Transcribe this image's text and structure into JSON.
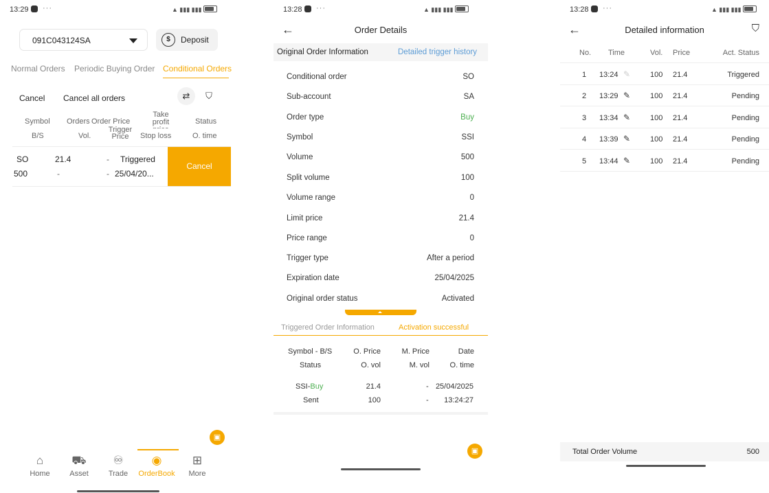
{
  "colors": {
    "accent": "#f5a800",
    "buy": "#4caf50",
    "link": "#5b9bd5",
    "muted": "#888888"
  },
  "screen1": {
    "status": {
      "time": "13:29",
      "dots": "···"
    },
    "account": {
      "value": "091C043124SA"
    },
    "deposit_label": "Deposit",
    "tabs": [
      "Normal Orders",
      "Periodic Buying Order",
      "Conditional Orders"
    ],
    "actions": {
      "cancel": "Cancel",
      "cancel_all": "Cancel all orders",
      "icon_refresh": "refresh-icon",
      "icon_filter": "filter-icon"
    },
    "headers": {
      "symbol": "Symbol",
      "bs": "B/S",
      "orders": "Orders",
      "vol": "Vol.",
      "order_price": "Order Price",
      "trigger_price": "Trigger Price",
      "take_profit": "Take profit price",
      "stop_loss": "Stop loss",
      "status": "Status",
      "otime": "O. time"
    },
    "row": {
      "symbol": "SO",
      "volume": "500",
      "order_price": "21.4",
      "trigger": "-",
      "take_profit": "-",
      "stop_loss": "-",
      "status": "Triggered",
      "time": "25/04/20...",
      "cancel": "Cancel"
    },
    "nav": [
      {
        "label": "Home",
        "icon": "home-icon"
      },
      {
        "label": "Asset",
        "icon": "asset-icon"
      },
      {
        "label": "Trade",
        "icon": "trade-icon"
      },
      {
        "label": "OrderBook",
        "icon": "orderbook-icon"
      },
      {
        "label": "More",
        "icon": "more-icon"
      }
    ]
  },
  "screen2": {
    "status": {
      "time": "13:28",
      "dots": "···"
    },
    "title": "Order Details",
    "tabs": [
      "Original Order Information",
      "Detailed trigger history"
    ],
    "fields": [
      {
        "label": "Conditional order",
        "value": "SO"
      },
      {
        "label": "Sub-account",
        "value": "SA"
      },
      {
        "label": "Order type",
        "value": "Buy"
      },
      {
        "label": "Symbol",
        "value": "SSI"
      },
      {
        "label": "Volume",
        "value": "500"
      },
      {
        "label": "Split volume",
        "value": "100"
      },
      {
        "label": "Volume range",
        "value": "0"
      },
      {
        "label": "Limit price",
        "value": "21.4"
      },
      {
        "label": "Price range",
        "value": "0"
      },
      {
        "label": "Trigger type",
        "value": "After a period"
      },
      {
        "label": "Expiration date",
        "value": "25/04/2025"
      },
      {
        "label": "Original order status",
        "value": "Activated"
      }
    ],
    "triggered": {
      "tab_label": "Triggered Order Information",
      "status_label": "Activation successful"
    },
    "thead": {
      "symbol_bs": "Symbol - B/S",
      "status": "Status",
      "oprice": "O. Price",
      "ovol": "O. vol",
      "mprice": "M. Price",
      "mvol": "M. vol",
      "date": "Date",
      "otime": "O. time"
    },
    "trow": {
      "symbol": "SSI-",
      "side": "Buy",
      "status": "Sent",
      "oprice": "21.4",
      "ovol": "100",
      "mprice": "-",
      "mvol": "-",
      "date": "25/04/2025",
      "otime": "13:24:27"
    }
  },
  "screen3": {
    "status": {
      "time": "13:28",
      "dots": "···"
    },
    "title": "Detailed information",
    "headers": {
      "no": "No.",
      "time": "Time",
      "vol": "Vol.",
      "price": "Price",
      "status": "Act. Status"
    },
    "rows": [
      {
        "no": "1",
        "time": "13:24",
        "vol": "100",
        "price": "21.4",
        "status": "Triggered"
      },
      {
        "no": "2",
        "time": "13:29",
        "vol": "100",
        "price": "21.4",
        "status": "Pending"
      },
      {
        "no": "3",
        "time": "13:34",
        "vol": "100",
        "price": "21.4",
        "status": "Pending"
      },
      {
        "no": "4",
        "time": "13:39",
        "vol": "100",
        "price": "21.4",
        "status": "Pending"
      },
      {
        "no": "5",
        "time": "13:44",
        "vol": "100",
        "price": "21.4",
        "status": "Pending"
      }
    ],
    "total": {
      "label": "Total Order Volume",
      "value": "500"
    }
  }
}
